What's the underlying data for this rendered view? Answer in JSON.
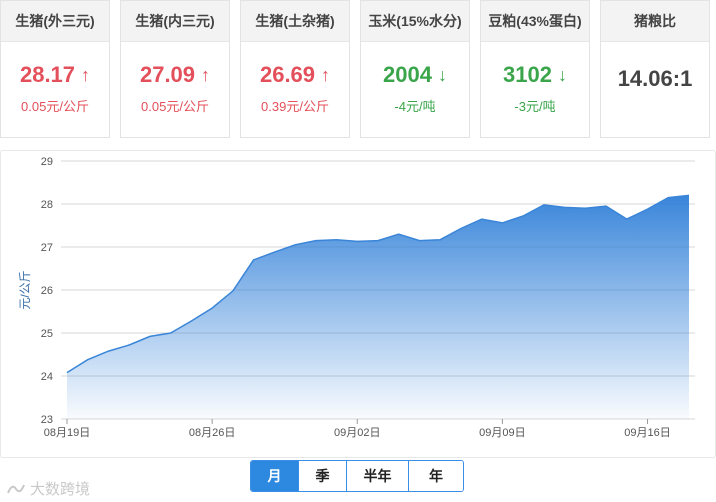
{
  "cards": [
    {
      "title": "生猪(外三元)",
      "value": "28.17",
      "change": "0.05元/公斤",
      "trend": "up",
      "arrow": "↑"
    },
    {
      "title": "生猪(内三元)",
      "value": "27.09",
      "change": "0.05元/公斤",
      "trend": "up",
      "arrow": "↑"
    },
    {
      "title": "生猪(土杂猪)",
      "value": "26.69",
      "change": "0.39元/公斤",
      "trend": "up",
      "arrow": "↑"
    },
    {
      "title": "玉米(15%水分)",
      "value": "2004",
      "change": "-4元/吨",
      "trend": "down",
      "arrow": "↓"
    },
    {
      "title": "豆粕(43%蛋白)",
      "value": "3102",
      "change": "-3元/吨",
      "trend": "down",
      "arrow": "↓"
    },
    {
      "title": "猪粮比",
      "value": "14.06:1",
      "change": "",
      "trend": "neutral",
      "arrow": ""
    }
  ],
  "colors": {
    "up": "#e34f5a",
    "down": "#3aa54a",
    "line": "#3a85d8",
    "accent": "#2d88e0"
  },
  "periods": [
    "月",
    "季",
    "半年",
    "年"
  ],
  "active_period": "月",
  "watermark": "大数跨境",
  "chart_data": {
    "type": "area",
    "title": "",
    "xlabel": "",
    "ylabel": "元/公斤",
    "ylim": [
      23,
      29
    ],
    "yticks": [
      23,
      24,
      25,
      26,
      27,
      28,
      29
    ],
    "x_tick_labels": [
      "08月19日",
      "08月26日",
      "09月02日",
      "09月09日",
      "09月16日"
    ],
    "x_tick_indices": [
      0,
      7,
      14,
      21,
      28
    ],
    "grid": true,
    "x": [
      "08月19日",
      "08月20日",
      "08月21日",
      "08月22日",
      "08月23日",
      "08月24日",
      "08月25日",
      "08月26日",
      "08月27日",
      "08月28日",
      "08月29日",
      "08月30日",
      "08月31日",
      "09月01日",
      "09月02日",
      "09月03日",
      "09月04日",
      "09月05日",
      "09月06日",
      "09月07日",
      "09月08日",
      "09月09日",
      "09月10日",
      "09月11日",
      "09月12日",
      "09月13日",
      "09月14日",
      "09月15日",
      "09月16日",
      "09月17日",
      "09月18日"
    ],
    "series": [
      {
        "values": [
          24.08,
          24.38,
          24.58,
          24.72,
          24.92,
          25.0,
          25.28,
          25.58,
          25.98,
          26.7,
          26.88,
          27.05,
          27.15,
          27.17,
          27.13,
          27.15,
          27.3,
          27.15,
          27.17,
          27.43,
          27.65,
          27.56,
          27.72,
          27.98,
          27.92,
          27.9,
          27.95,
          27.65,
          27.88,
          28.15,
          28.2
        ]
      }
    ]
  }
}
